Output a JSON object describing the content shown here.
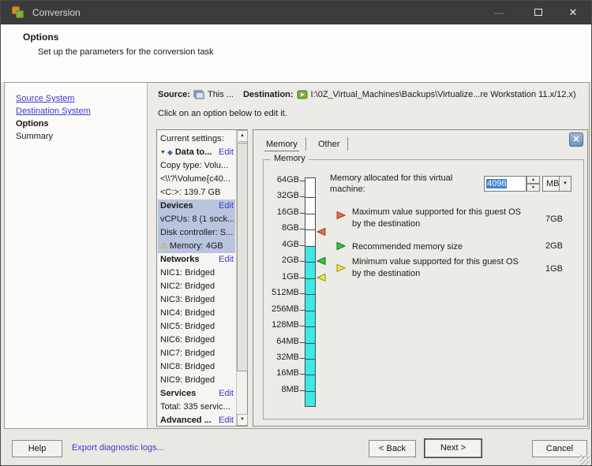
{
  "window": {
    "title": "Conversion"
  },
  "header": {
    "title": "Options",
    "subtitle": "Set up the parameters for the conversion task"
  },
  "nav": {
    "items": [
      {
        "label": "Source System",
        "style": "link"
      },
      {
        "label": "Destination System",
        "style": "link"
      },
      {
        "label": "Options",
        "style": "current"
      },
      {
        "label": "Summary",
        "style": "plain"
      }
    ]
  },
  "summary_bar": {
    "source_label": "Source:",
    "source_value": "This ...",
    "destination_label": "Destination:",
    "destination_value": "I:\\0Z_Virtual_Machines\\Backups\\Virtualize...re Workstation 11.x/12.x)",
    "instruction": "Click on an option below to edit it."
  },
  "settings_tree": {
    "edit_label": "Edit",
    "items": [
      {
        "label": "Current settings:"
      },
      {
        "label": "Data to...",
        "bold": true,
        "edit": true,
        "expander": true,
        "diamond": true
      },
      {
        "label": "Copy type: Volu..."
      },
      {
        "label": "<\\\\?\\Volume{c40..."
      },
      {
        "label": "<C:>: 139.7 GB"
      },
      {
        "label": "Devices",
        "bold": true,
        "edit": true,
        "selected": true
      },
      {
        "label": "vCPUs: 8 (1 sock...",
        "selected": true
      },
      {
        "label": "Disk controller: S...",
        "selected": true
      },
      {
        "label": "Memory: 4GB",
        "selected": true,
        "warning": true
      },
      {
        "label": "Networks",
        "bold": true,
        "edit": true
      },
      {
        "label": "NIC1: Bridged"
      },
      {
        "label": "NIC2: Bridged"
      },
      {
        "label": "NIC3: Bridged"
      },
      {
        "label": "NIC4: Bridged"
      },
      {
        "label": "NIC5: Bridged"
      },
      {
        "label": "NIC6: Bridged"
      },
      {
        "label": "NIC7: Bridged"
      },
      {
        "label": "NIC8: Bridged"
      },
      {
        "label": "NIC9: Bridged"
      },
      {
        "label": "Services",
        "bold": true,
        "edit": true
      },
      {
        "label": "Total: 335 servic..."
      },
      {
        "label": "Advanced ...",
        "bold": true,
        "edit": true
      }
    ]
  },
  "memory_panel": {
    "tabs": [
      {
        "label": "Memory",
        "selected": true
      },
      {
        "label": "Other",
        "selected": false
      }
    ],
    "close_glyph": "✕",
    "group_label": "Memory",
    "alloc_label": "Memory allocated for this virtual machine:",
    "alloc_value": "4096",
    "alloc_unit": "MB",
    "scale_labels": [
      "64GB",
      "32GB",
      "16GB",
      "8GB",
      "4GB",
      "2GB",
      "1GB",
      "512MB",
      "256MB",
      "128MB",
      "64MB",
      "32MB",
      "16MB",
      "8MB"
    ],
    "bar_fill_from_label": "4GB",
    "bar_fill_color": "#3BE9E9",
    "markers": [
      {
        "name": "maximum",
        "color": "#E0714A",
        "border": "#9C4420",
        "text": "Maximum value supported for this guest OS by the destination",
        "value": "7GB"
      },
      {
        "name": "recommended",
        "color": "#33CC33",
        "border": "#157015",
        "text": "Recommended memory size",
        "value": "2GB"
      },
      {
        "name": "minimum",
        "color": "#EFE93F",
        "border": "#97901A",
        "text": "Minimum value supported for this guest OS by the destination",
        "value": "1GB"
      }
    ]
  },
  "footer": {
    "help": "Help",
    "export_link": "Export diagnostic logs...",
    "back": "< Back",
    "next": "Next >",
    "cancel": "Cancel"
  },
  "colors": {
    "selection": "#B9C5DF",
    "link": "#3B3BC8",
    "bar_fill": "#3BE9E9"
  }
}
